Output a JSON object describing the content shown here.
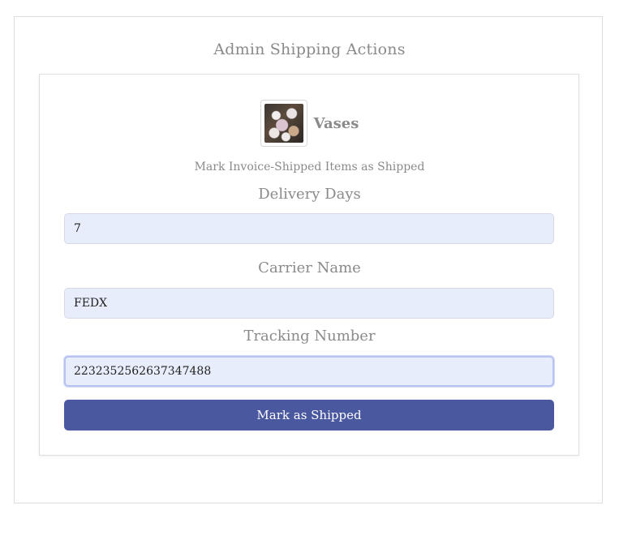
{
  "header": {
    "title": "Admin Shipping Actions"
  },
  "product": {
    "name": "Vases",
    "thumbnail_icon": "vase-flowers-image"
  },
  "form": {
    "subtitle": "Mark Invoice-Shipped Items as Shipped",
    "delivery_days": {
      "label": "Delivery Days",
      "value": "7"
    },
    "carrier_name": {
      "label": "Carrier Name",
      "value": "FEDX"
    },
    "tracking_number": {
      "label": "Tracking Number",
      "value": "2232352562637347488"
    },
    "submit_label": "Mark as Shipped"
  },
  "colors": {
    "accent": "#4a58a0",
    "input_bg": "#e8edfb",
    "muted_text": "#8a8a8a"
  }
}
